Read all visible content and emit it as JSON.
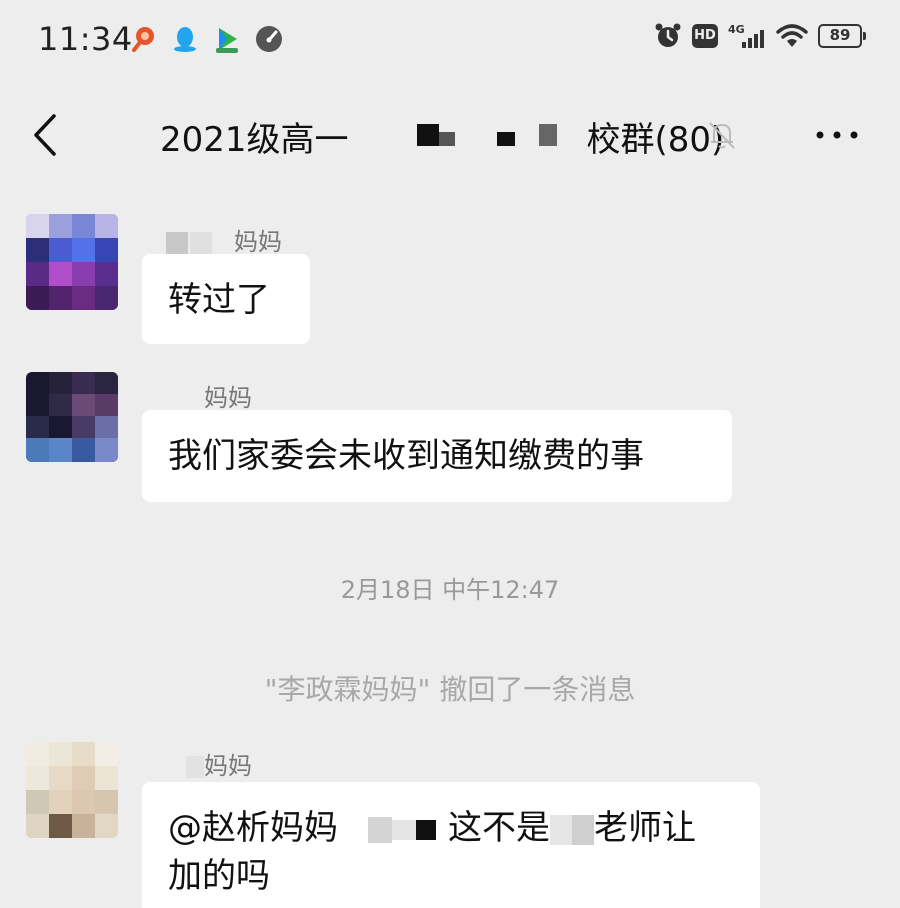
{
  "status_bar": {
    "time": "11:34",
    "battery": "89",
    "network": "4G",
    "hd": "HD",
    "notification_icons": [
      "music-app-icon",
      "qq-penguin-icon",
      "video-app-icon",
      "speedometer-icon"
    ],
    "system_icons": [
      "alarm-icon",
      "hd-icon",
      "signal-4g-icon",
      "wifi-icon",
      "battery-icon"
    ]
  },
  "header": {
    "title_prefix": "2021级高一",
    "title_suffix": "校群(80)",
    "back_icon": "chevron-left-icon",
    "mute_icon": "bell-muted-icon",
    "more_icon": "more-dots-icon"
  },
  "messages": [
    {
      "sender": "妈妈",
      "text": "转过了"
    },
    {
      "sender": "妈妈",
      "text": "我们家委会未收到通知缴费的事"
    }
  ],
  "separator_time": "2月18日 中午12:47",
  "recall_notice": "\"李政霖妈妈\" 撤回了一条消息",
  "message3": {
    "sender": "妈妈",
    "mention": "@赵析妈妈",
    "text_a": "这不是",
    "text_b": "老师让",
    "text_c": "加的吗"
  }
}
